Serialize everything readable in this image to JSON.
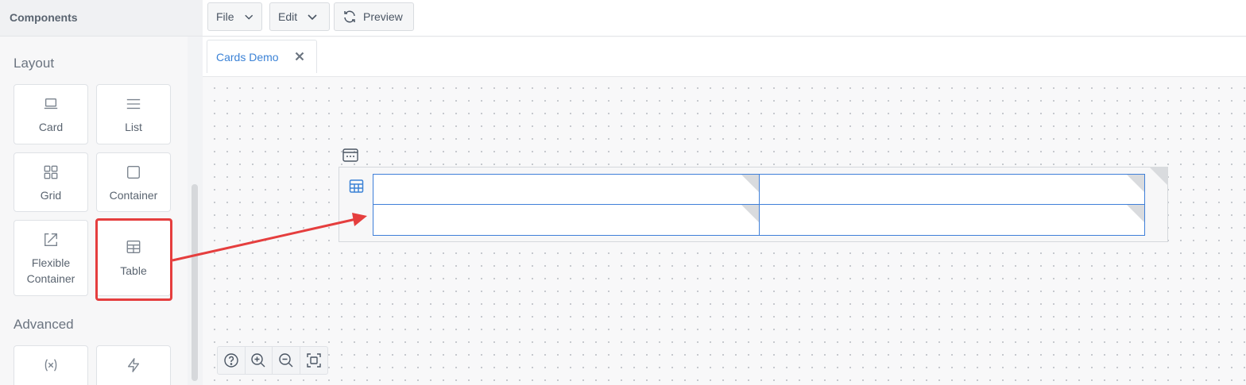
{
  "sidebar": {
    "title": "Components",
    "sections": [
      {
        "title": "Layout",
        "items": [
          {
            "label": "Card",
            "icon": "laptop-icon"
          },
          {
            "label": "List",
            "icon": "list-icon"
          },
          {
            "label": "Grid",
            "icon": "grid-icon"
          },
          {
            "label": "Container",
            "icon": "square-icon"
          },
          {
            "label": "Flexible Container",
            "icon": "resize-icon"
          },
          {
            "label": "Table",
            "icon": "table-icon"
          }
        ]
      },
      {
        "title": "Advanced",
        "items": [
          {
            "label": "",
            "icon": "variable-icon"
          },
          {
            "label": "",
            "icon": "lightning-icon"
          }
        ]
      }
    ]
  },
  "toolbar": {
    "file_label": "File",
    "edit_label": "Edit",
    "preview_label": "Preview"
  },
  "tabs": [
    {
      "label": "Cards Demo",
      "active": true
    }
  ],
  "canvas": {
    "table": {
      "rows": 2,
      "columns": 2
    }
  },
  "colors": {
    "accent": "#3b82d6",
    "annotation": "#e53e3e",
    "cell_border": "#3f7fd9"
  }
}
